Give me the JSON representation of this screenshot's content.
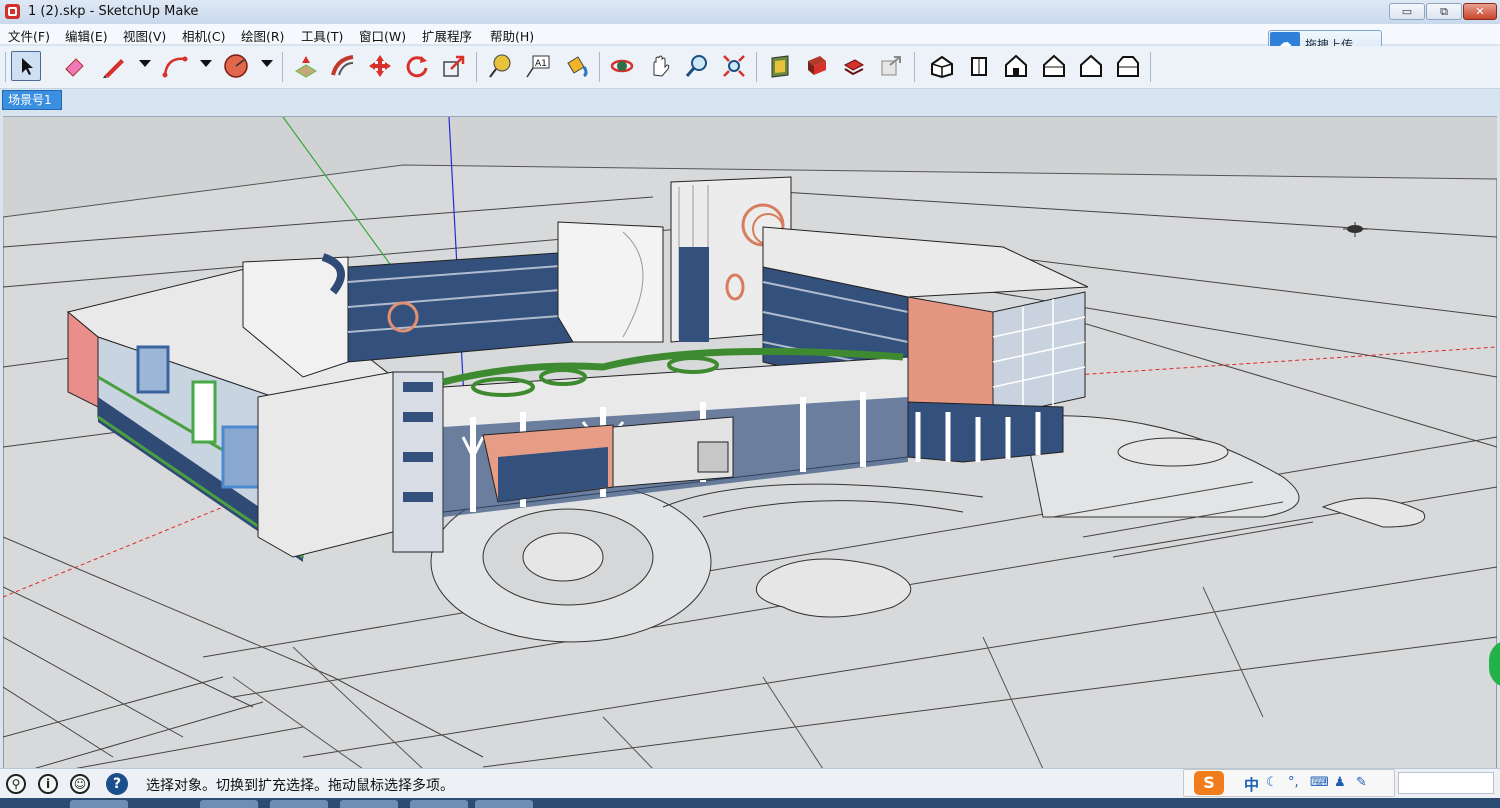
{
  "window": {
    "title": "1 (2).skp - SketchUp Make"
  },
  "window_controls": {
    "minimize": "▭",
    "restore": "⧉",
    "close": "✕"
  },
  "menu": [
    "文件(F)",
    "编辑(E)",
    "视图(V)",
    "相机(C)",
    "绘图(R)",
    "工具(T)",
    "窗口(W)",
    "扩展程序",
    "帮助(H)"
  ],
  "upload": {
    "label": "拖拽上传",
    "icon": "cloud-upload-icon"
  },
  "toolbar": {
    "tools": [
      "select-icon",
      "eraser-icon",
      "pencil-icon",
      "arc-icon",
      "shapes-icon",
      "push-pull-icon",
      "follow-me-icon",
      "move-icon",
      "rotate-icon",
      "scale-icon",
      "tape-measure-icon",
      "text-icon",
      "paint-bucket-icon",
      "orbit-icon",
      "pan-icon",
      "zoom-icon",
      "zoom-extents-icon",
      "3d-warehouse-icon",
      "extension-warehouse-icon",
      "layout-icon",
      "share-model-icon",
      "iso-view-icon",
      "top-view-icon",
      "front-view-icon",
      "right-view-icon",
      "back-view-icon",
      "left-view-icon"
    ],
    "text_tool_glyph": "A1"
  },
  "scene_tab": {
    "label": "场景号1"
  },
  "status": {
    "message": "选择对象。切换到扩充选择。拖动鼠标选择多项。",
    "help_glyph": "?",
    "info_glyph": "i"
  },
  "ime": {
    "logo": "S",
    "mode": "中",
    "icons": [
      "moon-icon",
      "punctuation-icon",
      "keyboard-icon",
      "user-icon",
      "wrench-icon"
    ]
  },
  "colors": {
    "scene_tab": "#3b8fe0",
    "ground": "#d4d6d8",
    "building_blue": "#3a5580",
    "salmon": "#e59680",
    "green_axis": "#38a838",
    "blue_axis": "#1f2fd8",
    "red_axis": "#e02a2a"
  }
}
